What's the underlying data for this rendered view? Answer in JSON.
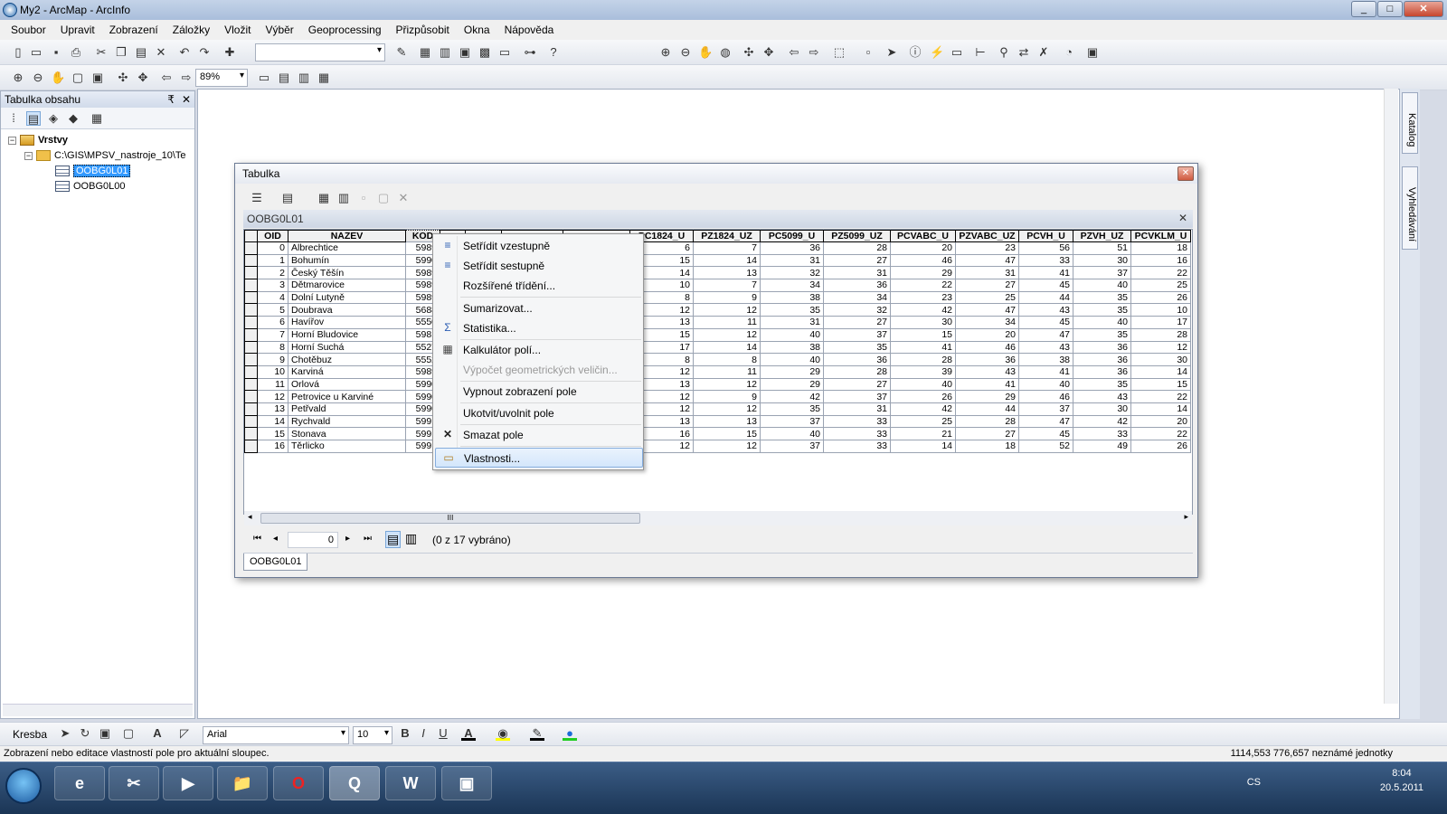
{
  "window": {
    "title": "My2 - ArcMap - ArcInfo",
    "min": "_",
    "max": "□",
    "close": "✕"
  },
  "menu": [
    "Soubor",
    "Upravit",
    "Zobrazení",
    "Záložky",
    "Vložit",
    "Výběr",
    "Geoprocessing",
    "Přizpůsobit",
    "Okna",
    "Nápověda"
  ],
  "toolbar2": {
    "zoom": "89%"
  },
  "toc": {
    "title": "Tabulka obsahu",
    "pin": "₹",
    "close": "✕",
    "layers": "Vrstvy",
    "folder": "C:\\GIS\\MPSV_nastroje_10\\Te",
    "table1": "OOBG0L01",
    "table2": "OOBG0L00"
  },
  "sidepanel": {
    "katalog": "Katalog",
    "hledani": "Vyhledávání"
  },
  "table_window": {
    "title": "Tabulka",
    "close": "✕",
    "layer_title": "OOBG0L01",
    "layer_close": "✕",
    "status": "(0 z 17 vybráno)",
    "record": "0",
    "tab_name": "OOBG0L01",
    "scroll_grip": "III"
  },
  "grid": {
    "columns": [
      "OID",
      "NAZEV",
      "KOD",
      "",
      "",
      "",
      "",
      "PC1824_U",
      "PZ1824_UZ",
      "PC5099_U",
      "PZ5099_UZ",
      "PCVABC_U",
      "PZVABC_UZ",
      "PCVH_U",
      "PZVH_UZ",
      "PCVKLM_U"
    ],
    "rows": [
      [
        "0",
        "Albrechtice",
        "5989",
        "6",
        "7",
        "36",
        "28",
        "20",
        "23",
        "56",
        "51",
        "18"
      ],
      [
        "1",
        "Bohumín",
        "5990",
        "15",
        "14",
        "31",
        "27",
        "46",
        "47",
        "33",
        "30",
        "16"
      ],
      [
        "2",
        "Český Těšín",
        "5989",
        "14",
        "13",
        "32",
        "31",
        "29",
        "31",
        "41",
        "37",
        "22"
      ],
      [
        "3",
        "Dětmarovice",
        "5989",
        "10",
        "7",
        "34",
        "36",
        "22",
        "27",
        "45",
        "40",
        "25"
      ],
      [
        "4",
        "Dolní Lutyně",
        "5989",
        "8",
        "9",
        "38",
        "34",
        "23",
        "25",
        "44",
        "35",
        "26"
      ],
      [
        "5",
        "Doubrava",
        "5688",
        "12",
        "12",
        "35",
        "32",
        "42",
        "47",
        "43",
        "35",
        "10"
      ],
      [
        "6",
        "Havířov",
        "5550",
        "13",
        "11",
        "31",
        "27",
        "30",
        "34",
        "45",
        "40",
        "17"
      ],
      [
        "7",
        "Horní Bludovice",
        "5981",
        "15",
        "12",
        "40",
        "37",
        "15",
        "20",
        "47",
        "35",
        "28"
      ],
      [
        "8",
        "Horní Suchá",
        "5527",
        "17",
        "14",
        "38",
        "35",
        "41",
        "46",
        "43",
        "36",
        "12"
      ],
      [
        "9",
        "Chotěbuz",
        "5552",
        "8",
        "8",
        "40",
        "36",
        "28",
        "36",
        "38",
        "36",
        "30"
      ],
      [
        "10",
        "Karviná",
        "5989",
        "12",
        "11",
        "29",
        "28",
        "39",
        "43",
        "41",
        "36",
        "14"
      ],
      [
        "11",
        "Orlová",
        "5990",
        "13",
        "12",
        "29",
        "27",
        "40",
        "41",
        "40",
        "35",
        "15"
      ],
      [
        "12",
        "Petrovice u Karviné",
        "5990",
        "12",
        "9",
        "42",
        "37",
        "26",
        "29",
        "46",
        "43",
        "22"
      ],
      [
        "13",
        "Petřvald",
        "5990",
        "12",
        "12",
        "35",
        "31",
        "42",
        "44",
        "37",
        "30",
        "14"
      ],
      [
        "14",
        "Rychvald",
        "5991",
        "13",
        "13",
        "37",
        "33",
        "25",
        "28",
        "47",
        "42",
        "20"
      ],
      [
        "15",
        "Stonava",
        "5991",
        "16",
        "15",
        "40",
        "33",
        "21",
        "27",
        "45",
        "33",
        "22"
      ],
      [
        "16",
        "Těrlicko",
        "5991",
        "12",
        "12",
        "37",
        "33",
        "14",
        "18",
        "52",
        "49",
        "26"
      ]
    ]
  },
  "context_menu": {
    "sort_asc": "Setřídit vzestupně",
    "sort_desc": "Setřídit sestupně",
    "adv_sort": "Rozšířené třídění...",
    "summarize": "Sumarizovat...",
    "statistics": "Statistika...",
    "field_calc": "Kalkulátor polí...",
    "calc_geom": "Výpočet geometrických veličin...",
    "hide_field": "Vypnout zobrazení pole",
    "freeze": "Ukotvit/uvolnit pole",
    "delete_field": "Smazat pole",
    "properties": "Vlastnosti..."
  },
  "drawbar": {
    "kresba": "Kresba",
    "font": "Arial",
    "size": "10",
    "bold": "B",
    "italic": "I",
    "underline": "U",
    "fontcolor": "A"
  },
  "status": {
    "text": "Zobrazení nebo editace vlastností pole pro aktuální sloupec.",
    "coords": "1114,553  776,657 neznámé jednotky"
  },
  "tray": {
    "lang": "CS",
    "time": "8:04",
    "date": "20.5.2011"
  },
  "taskbar_apps": [
    "e",
    "✂",
    "▶",
    "📁",
    "O",
    "Q",
    "W",
    "▣"
  ]
}
